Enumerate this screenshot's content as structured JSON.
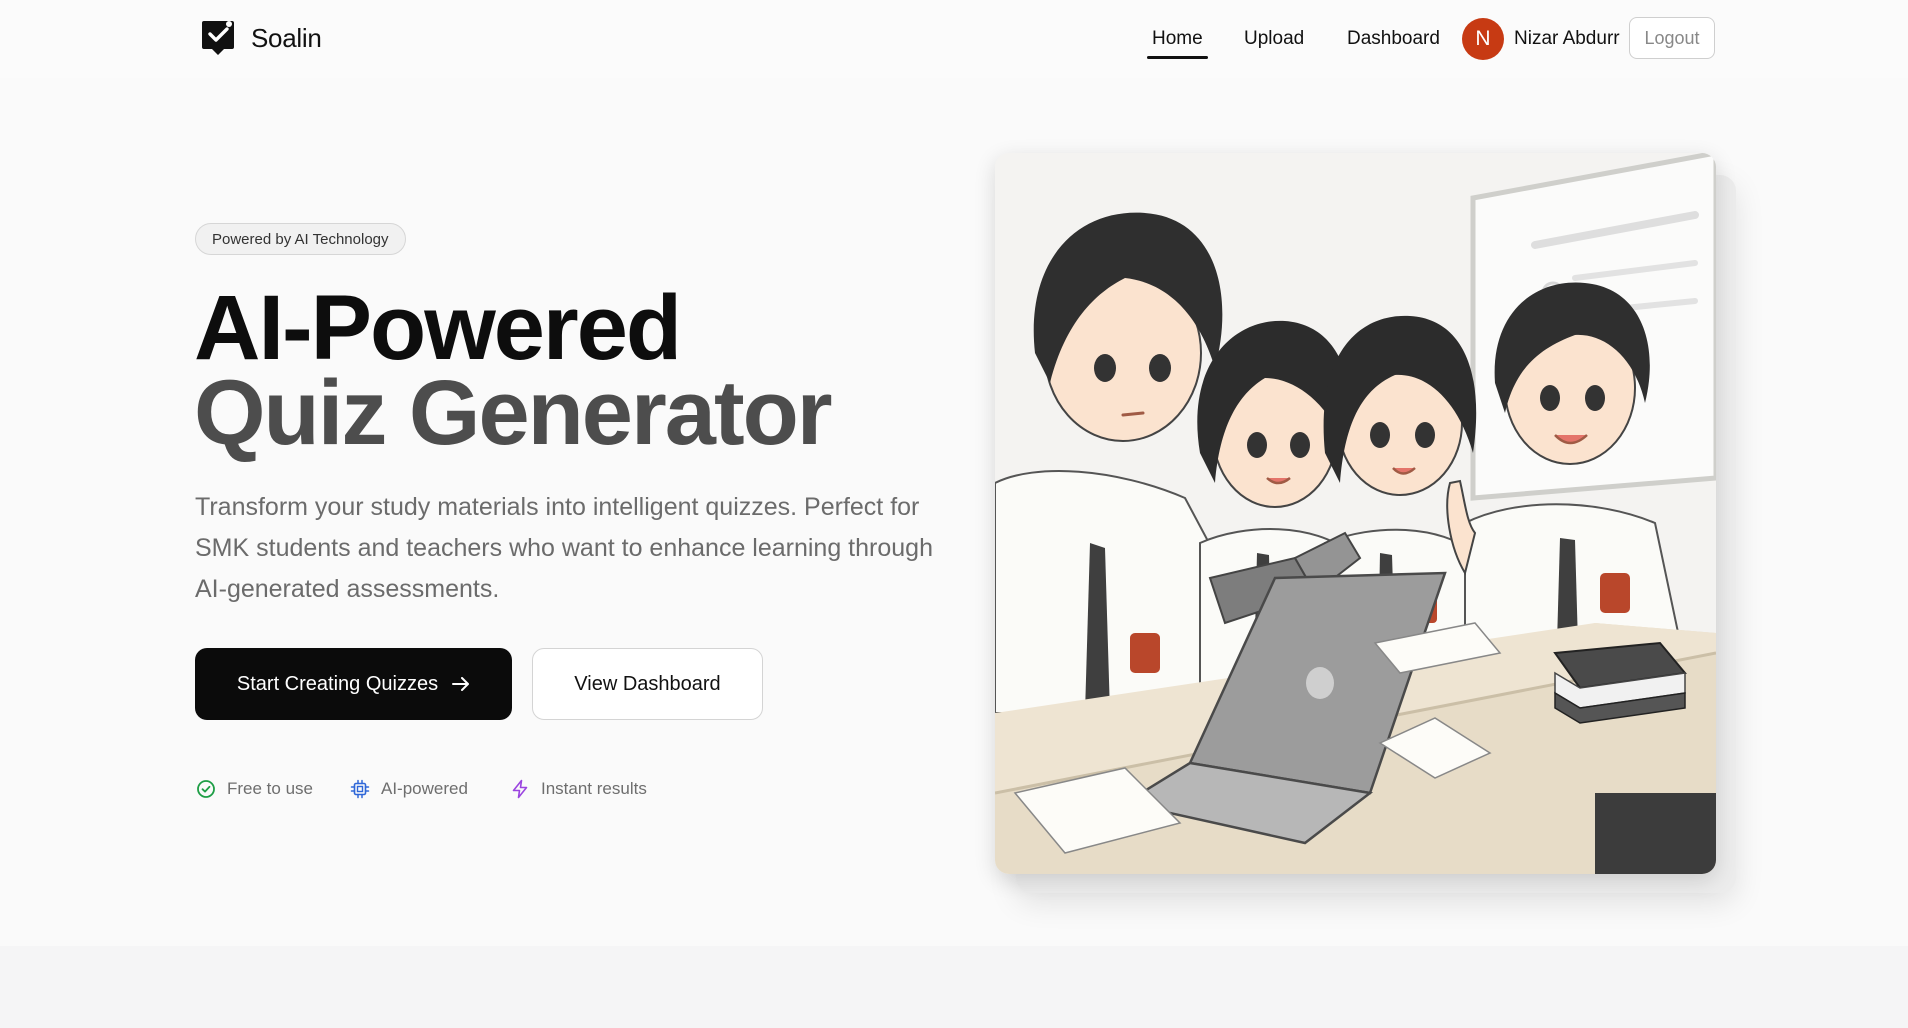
{
  "app": {
    "name": "Soalin",
    "logo_icon": "check-badge-icon"
  },
  "nav": {
    "items": [
      {
        "label": "Home",
        "active": true
      },
      {
        "label": "Upload",
        "active": false
      },
      {
        "label": "Dashboard",
        "active": false
      }
    ]
  },
  "user": {
    "initial": "N",
    "name": "Nizar Abdurr",
    "avatar_color": "#c73a13",
    "logout_label": "Logout"
  },
  "hero": {
    "badge": "Powered by AI Technology",
    "title_line1": "AI-Powered",
    "title_line2": "Quiz Generator",
    "description": "Transform your study materials into intelligent quizzes. Perfect for SMK students and teachers who want to enhance learning through AI-generated assessments.",
    "primary_button": "Start Creating Quizzes",
    "secondary_button": "View Dashboard",
    "features": [
      {
        "label": "Free to use",
        "icon": "check-circle-icon",
        "color": "#1e9e46"
      },
      {
        "label": "AI-powered",
        "icon": "cpu-icon",
        "color": "#2f67d8"
      },
      {
        "label": "Instant results",
        "icon": "lightning-icon",
        "color": "#9b45e0"
      }
    ]
  },
  "illustration": {
    "description_icon": "students-laptop-illustration"
  }
}
